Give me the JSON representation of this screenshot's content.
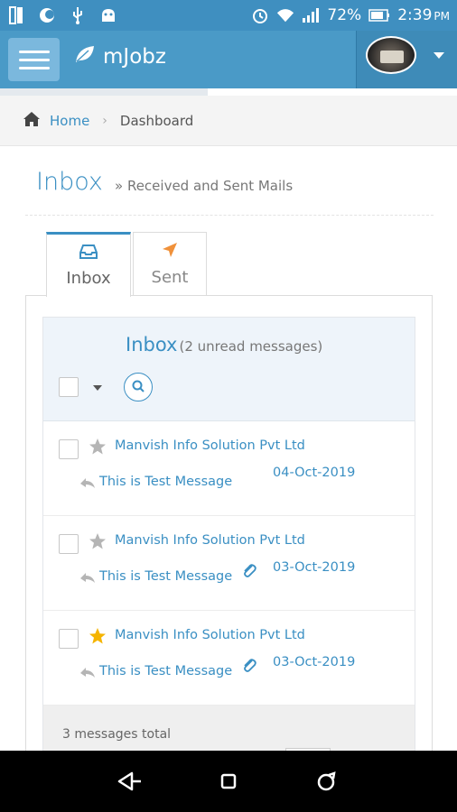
{
  "status_bar": {
    "battery": "72%",
    "time": "2:39",
    "ampm": "PM",
    "left_icons": [
      "sim-card-icon",
      "moon-icon",
      "usb-icon",
      "android-icon"
    ],
    "right_icons": [
      "alarm-icon",
      "wifi-icon",
      "signal-icon",
      "battery-icon"
    ]
  },
  "header": {
    "app_name": "mJobz",
    "menu_icon": "hamburger-icon",
    "logo_icon": "leaf-icon"
  },
  "breadcrumb": {
    "home": "Home",
    "current": "Dashboard"
  },
  "page": {
    "title": "Inbox",
    "subtitle": "» Received and Sent Mails"
  },
  "tabs": [
    {
      "label": "Inbox",
      "icon": "inbox-icon",
      "active": true
    },
    {
      "label": "Sent",
      "icon": "send-icon",
      "active": false
    }
  ],
  "mailbox": {
    "title": "Inbox",
    "unread": "(2 unread messages)",
    "footer": "3 messages total"
  },
  "messages": [
    {
      "sender": "Manvish Info Solution Pvt Ltd",
      "subject": "This is Test Message",
      "date": "04-Oct-2019",
      "starred": false,
      "attachment": false
    },
    {
      "sender": "Manvish Info Solution Pvt Ltd",
      "subject": "This is Test Message",
      "date": "03-Oct-2019",
      "starred": false,
      "attachment": true
    },
    {
      "sender": "Manvish Info Solution Pvt Ltd",
      "subject": "This is Test Message",
      "date": "03-Oct-2019",
      "starred": true,
      "attachment": true
    }
  ],
  "colors": {
    "status_bar": "#3f8fc0",
    "header": "#4a9ac7",
    "accent": "#3a8fc3",
    "star_active": "#f5b400",
    "star_inactive": "#b5b5b5",
    "sent_icon": "#f0913a"
  }
}
